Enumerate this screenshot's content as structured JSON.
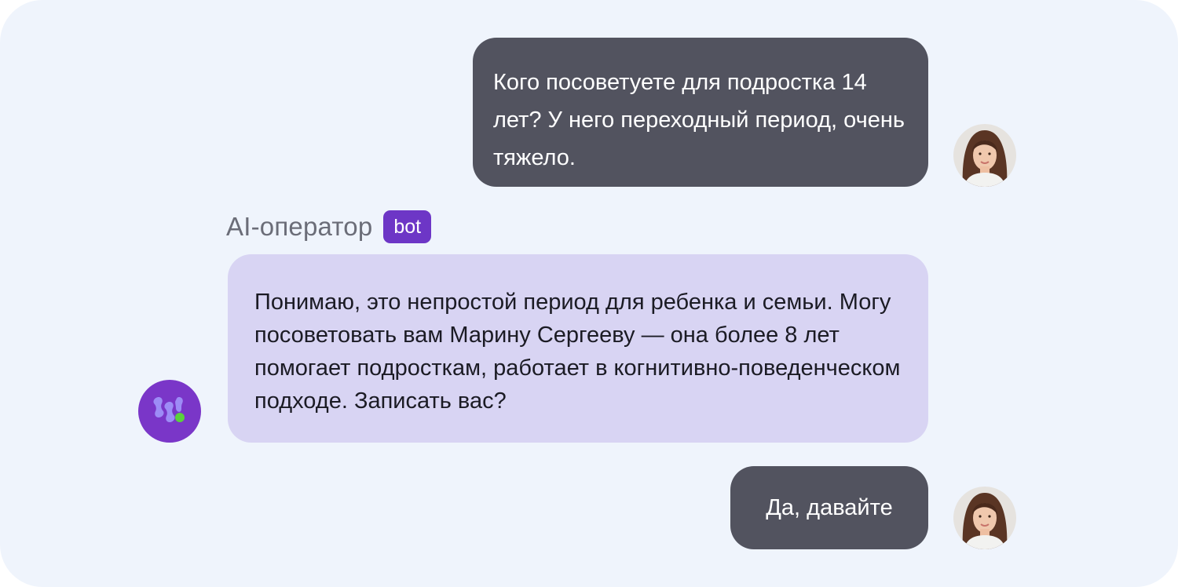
{
  "messages": [
    {
      "role": "user",
      "text": "Кого посоветуете для подростка 14 лет? У него переходный период, очень тяжело."
    },
    {
      "role": "bot",
      "text": "Понимаю, это непростой период для ребенка и семьи. Могу посоветовать вам Марину Сергееву — она более 8 лет помогает подросткам, работает в когнитивно-поведенческом подходе. Записать вас?"
    },
    {
      "role": "user",
      "text": "Да, давайте"
    }
  ],
  "bot_sender": {
    "name": "AI-оператор",
    "badge": "bot"
  },
  "icons": {
    "user_avatar": "user-photo-avatar",
    "bot_avatar": "bot-logo-icon"
  },
  "colors": {
    "background": "#eff4fc",
    "user_bubble": "#52535f",
    "bot_bubble": "#d8d4f3",
    "badge": "#6d36c6",
    "bot_avatar": "#7a36c8",
    "status_dot": "#5ad13c"
  }
}
